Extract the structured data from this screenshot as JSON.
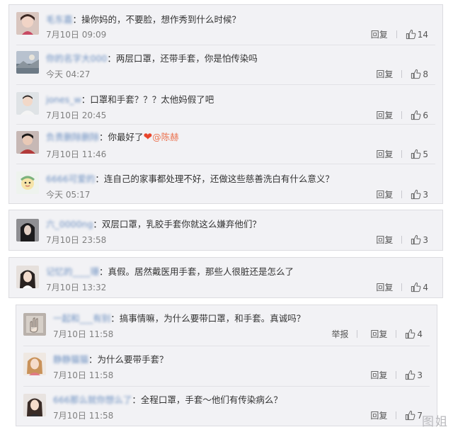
{
  "colors": {
    "card_bg": "#f2f2f5",
    "username": "#6b8fc0",
    "mention": "#eb7350",
    "heart": "#e8452c",
    "time": "#808080",
    "watermark": "#b9b9bd"
  },
  "cards": [
    {
      "comments": [
        {
          "username": "毛东嘉",
          "text": "：操你妈的，不要脸，想作秀到什么时候？",
          "time": "7月10日 09:09",
          "reply": "回复",
          "likes": "14",
          "avatar": "avatar-girl-icon"
        },
        {
          "username": "你的名字大000",
          "text": "：两层口罩，还带手套，你是怕传染吗",
          "time": "今天 04:27",
          "reply": "回复",
          "likes": "8",
          "avatar": "avatar-landscape-icon"
        },
        {
          "username": "jones_w",
          "text": "：口罩和手套？？？太他妈假了吧",
          "time": "7月10日 20:45",
          "reply": "回复",
          "likes": "6",
          "avatar": "avatar-boy-icon"
        },
        {
          "username": "负责删除删除",
          "text": "：你最好了",
          "heart": "❤",
          "mention": "@陈赫",
          "time": "7月10日 11:46",
          "reply": "回复",
          "likes": "5",
          "avatar": "avatar-man-icon"
        },
        {
          "username": "6666可爱的",
          "text": "：连自己的家事都处理不好，还做这些慈善洗白有什么意义？",
          "time": "今天 05:17",
          "reply": "回复",
          "likes": "3",
          "avatar": "avatar-cartoon-icon"
        }
      ]
    },
    {
      "comments": [
        {
          "username": "六_0000ng",
          "text": "：双层口罩，乳胶手套你就这么嫌弃他们？",
          "time": "7月10日 23:58",
          "reply": "回复",
          "likes": "3",
          "avatar": "avatar-dark-hair-icon"
        }
      ]
    },
    {
      "comments": [
        {
          "username": "记忆的____珊",
          "text": "：真假。居然戴医用手套，那些人很脏还是怎么了",
          "time": "7月10日 13:32",
          "reply": "回复",
          "likes": "4",
          "avatar": "avatar-woman-icon"
        }
      ]
    },
    {
      "comments": [
        {
          "username": "一起和___有别",
          "text": "：搞事情嘛，为什么要带口罩，和手套。真诚吗？",
          "time": "7月10日 11:58",
          "report": "举报",
          "reply": "回复",
          "likes": "4",
          "avatar": "avatar-hand-icon"
        },
        {
          "username": "静静猫猫",
          "text": "：为什么要带手套？",
          "time": "7月10日 11:58",
          "reply": "回复",
          "likes": "3",
          "avatar": "avatar-blonde-icon"
        },
        {
          "username": "666那么就你想么了",
          "text": "：全程口罩，手套～他们有传染病么？",
          "time": "7月10日 11:58",
          "reply": "回复",
          "likes": "7",
          "avatar": "avatar-long-hair-icon"
        }
      ]
    }
  ],
  "watermark": "图姐"
}
